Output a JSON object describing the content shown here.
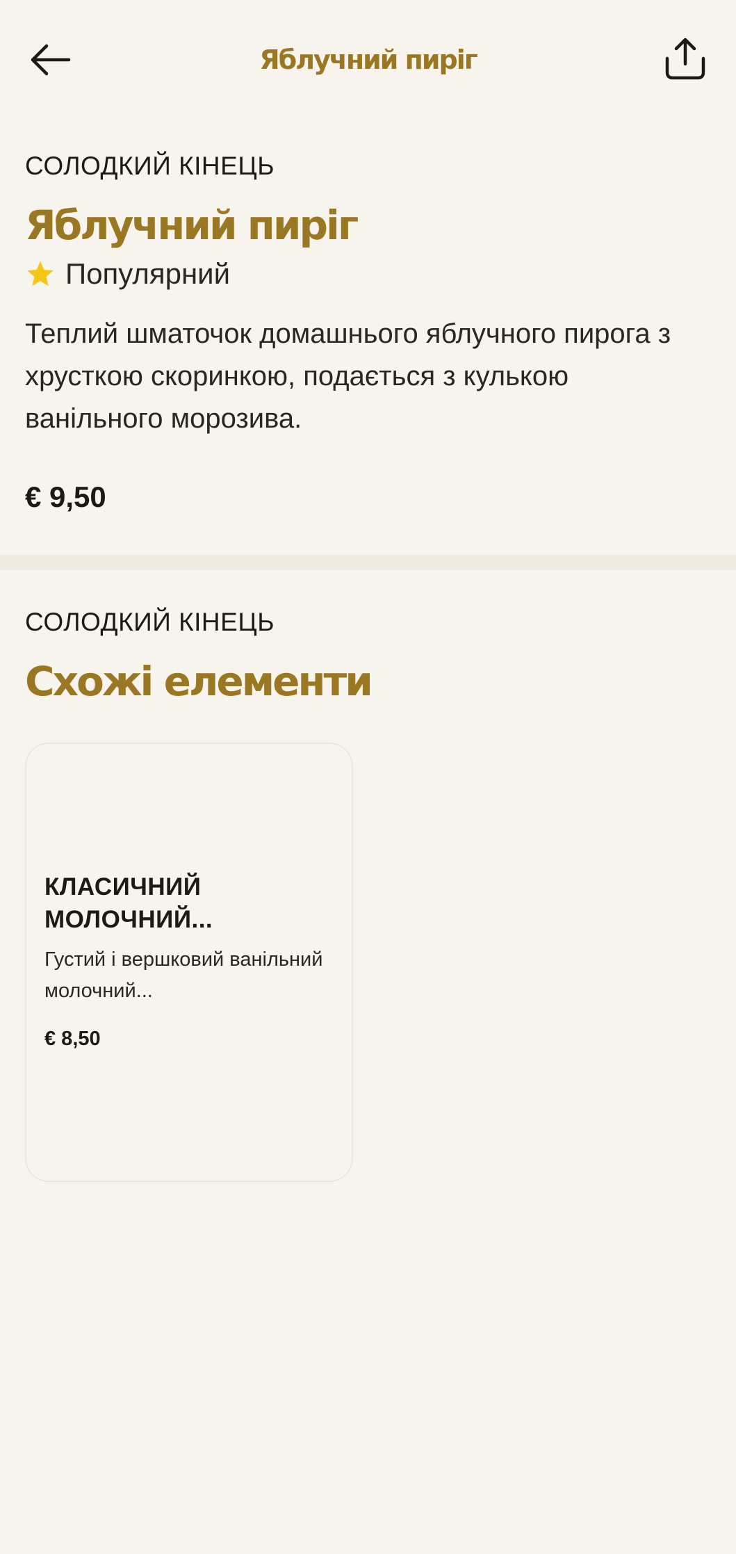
{
  "header": {
    "title": "Яблучний пиріг",
    "back_icon": "arrow-left-icon",
    "share_icon": "share-icon"
  },
  "item": {
    "category": "СОЛОДКИЙ КІНЕЦЬ",
    "name": "Яблучний пиріг",
    "badge": "Популярний",
    "badge_icon": "star-icon",
    "description": "Теплий шматочок домашнього яблучного пирога з хрусткою скоринкою, подається з кулькою ванільного морозива.",
    "price": "€ 9,50"
  },
  "similar": {
    "category": "СОЛОДКИЙ КІНЕЦЬ",
    "title": "Схожі елементи",
    "items": [
      {
        "name": "КЛАСИЧНИЙ МОЛОЧНИЙ...",
        "description": "Густий і вершковий ванільний молочний...",
        "price": "€ 8,50"
      }
    ]
  },
  "colors": {
    "background": "#f7f4ee",
    "accent": "#9a7722",
    "star": "#f5c518",
    "text": "#1d1a14",
    "divider": "#efebe2"
  }
}
